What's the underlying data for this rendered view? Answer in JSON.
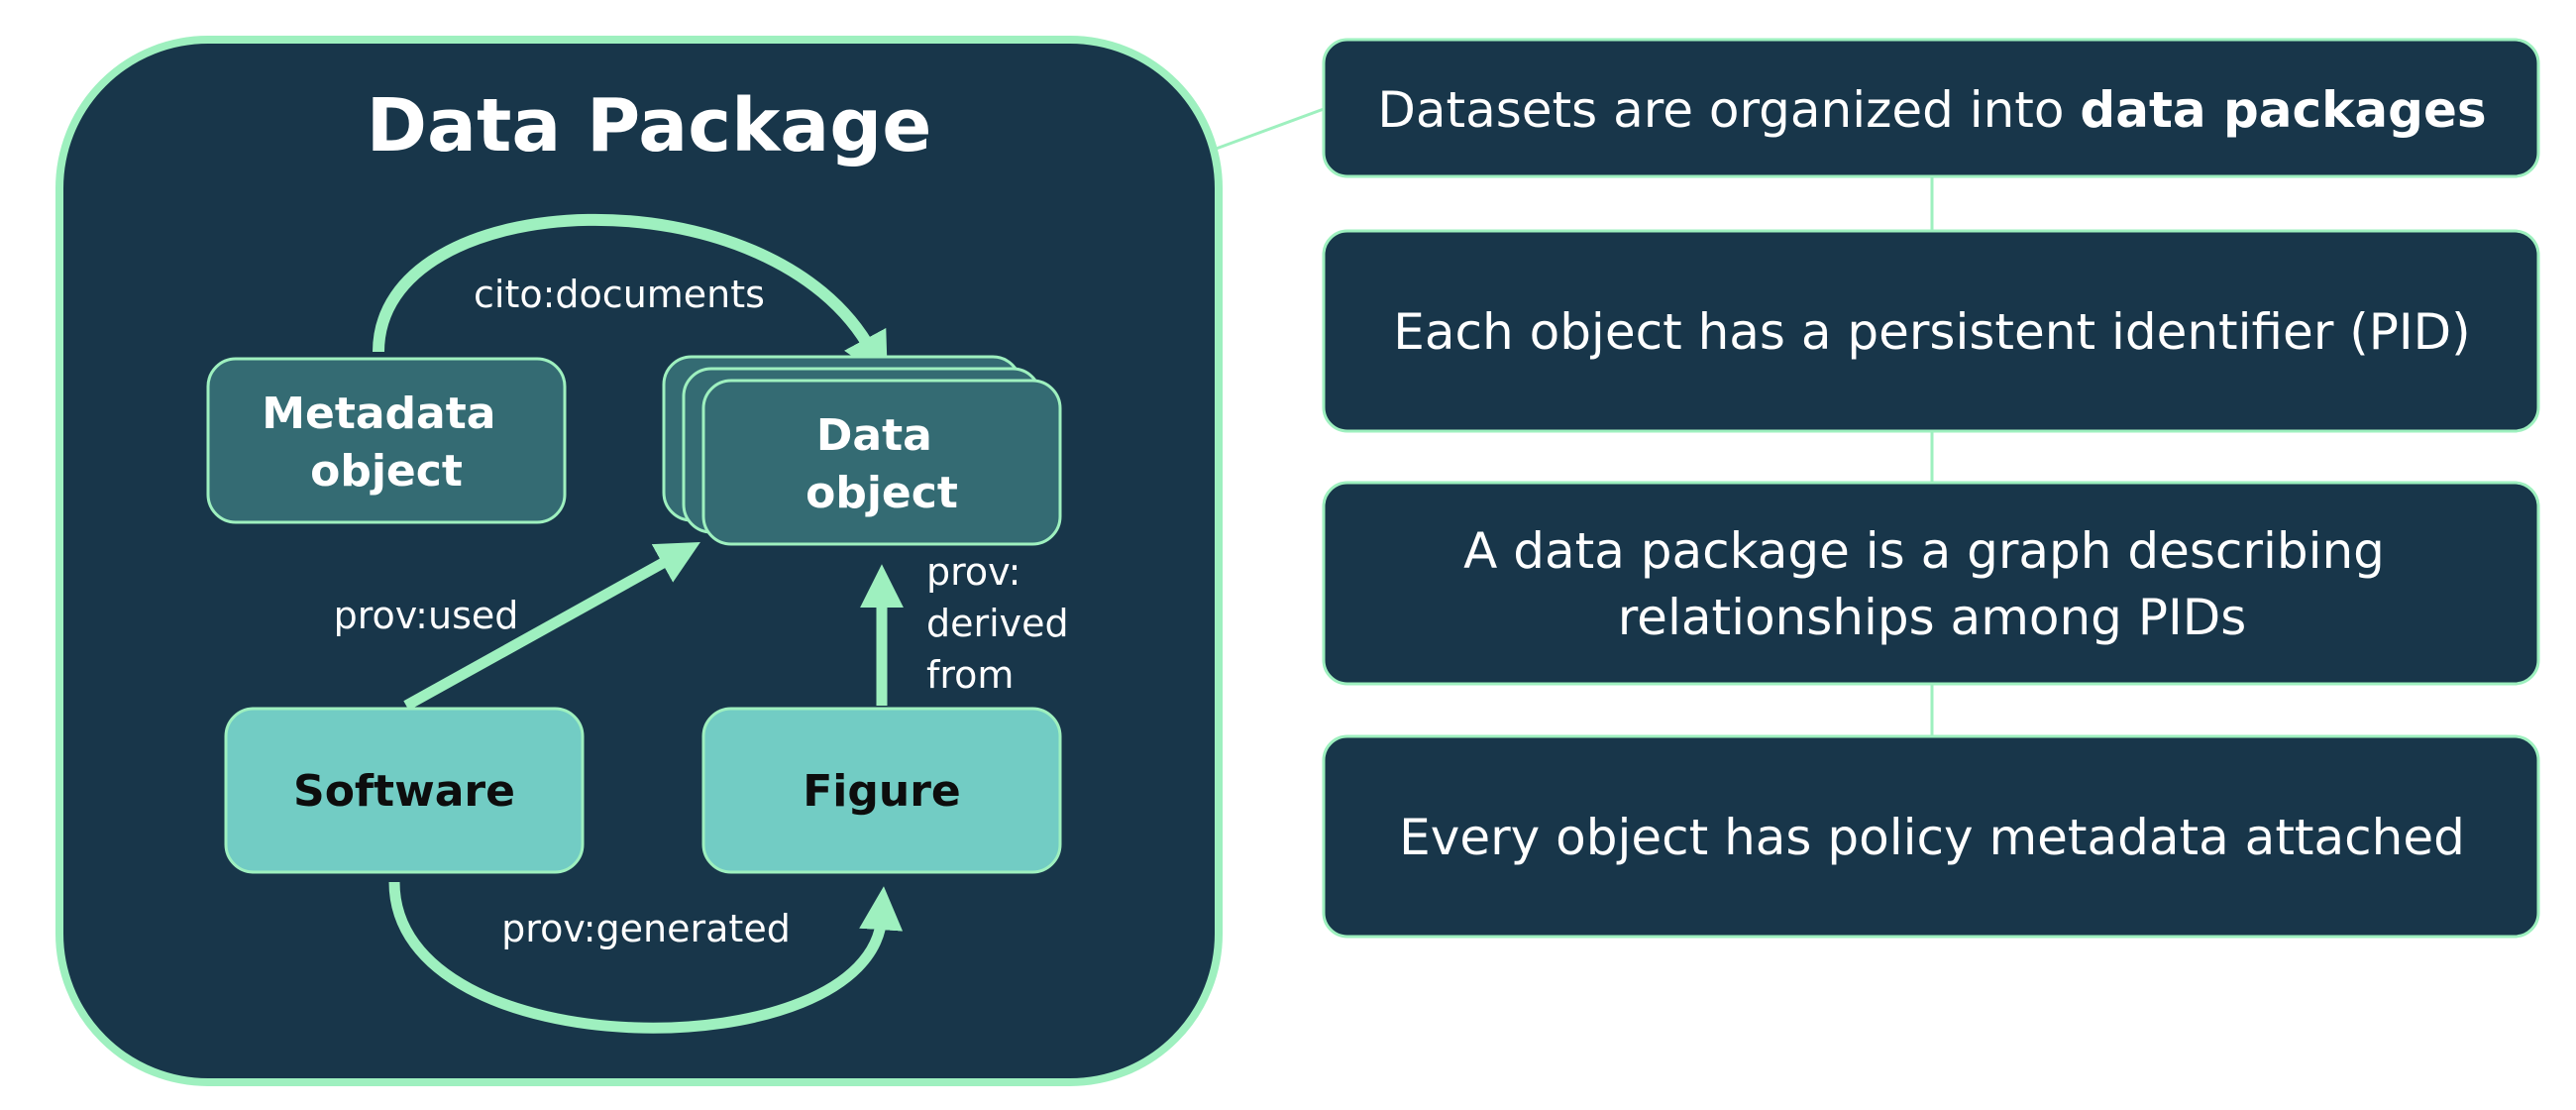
{
  "package": {
    "title": "Data Package"
  },
  "nodes": {
    "metadata": [
      "Metadata",
      "object"
    ],
    "data": [
      "Data",
      "object"
    ],
    "software": "Software",
    "figure": "Figure"
  },
  "edges": {
    "documents": "cito:documents",
    "used": "prov:used",
    "derived": [
      "prov:",
      "derived",
      "from"
    ],
    "generated": "prov:generated"
  },
  "panels": [
    {
      "lines": [
        {
          "text": "Datasets are organized into ",
          "strong": "data packages"
        }
      ]
    },
    {
      "lines": [
        {
          "text": "Each object has a persistent identifier (PID)"
        }
      ]
    },
    {
      "lines": [
        {
          "text": "A data package is a graph describing"
        },
        {
          "text": "relationships among PIDs"
        }
      ]
    },
    {
      "lines": [
        {
          "text": "Every object has policy metadata attached"
        }
      ]
    }
  ],
  "colors": {
    "navy": "#18364a",
    "mint": "#9ef0bf",
    "teal_dark": "#346b73",
    "teal_light": "#72ccc4"
  }
}
